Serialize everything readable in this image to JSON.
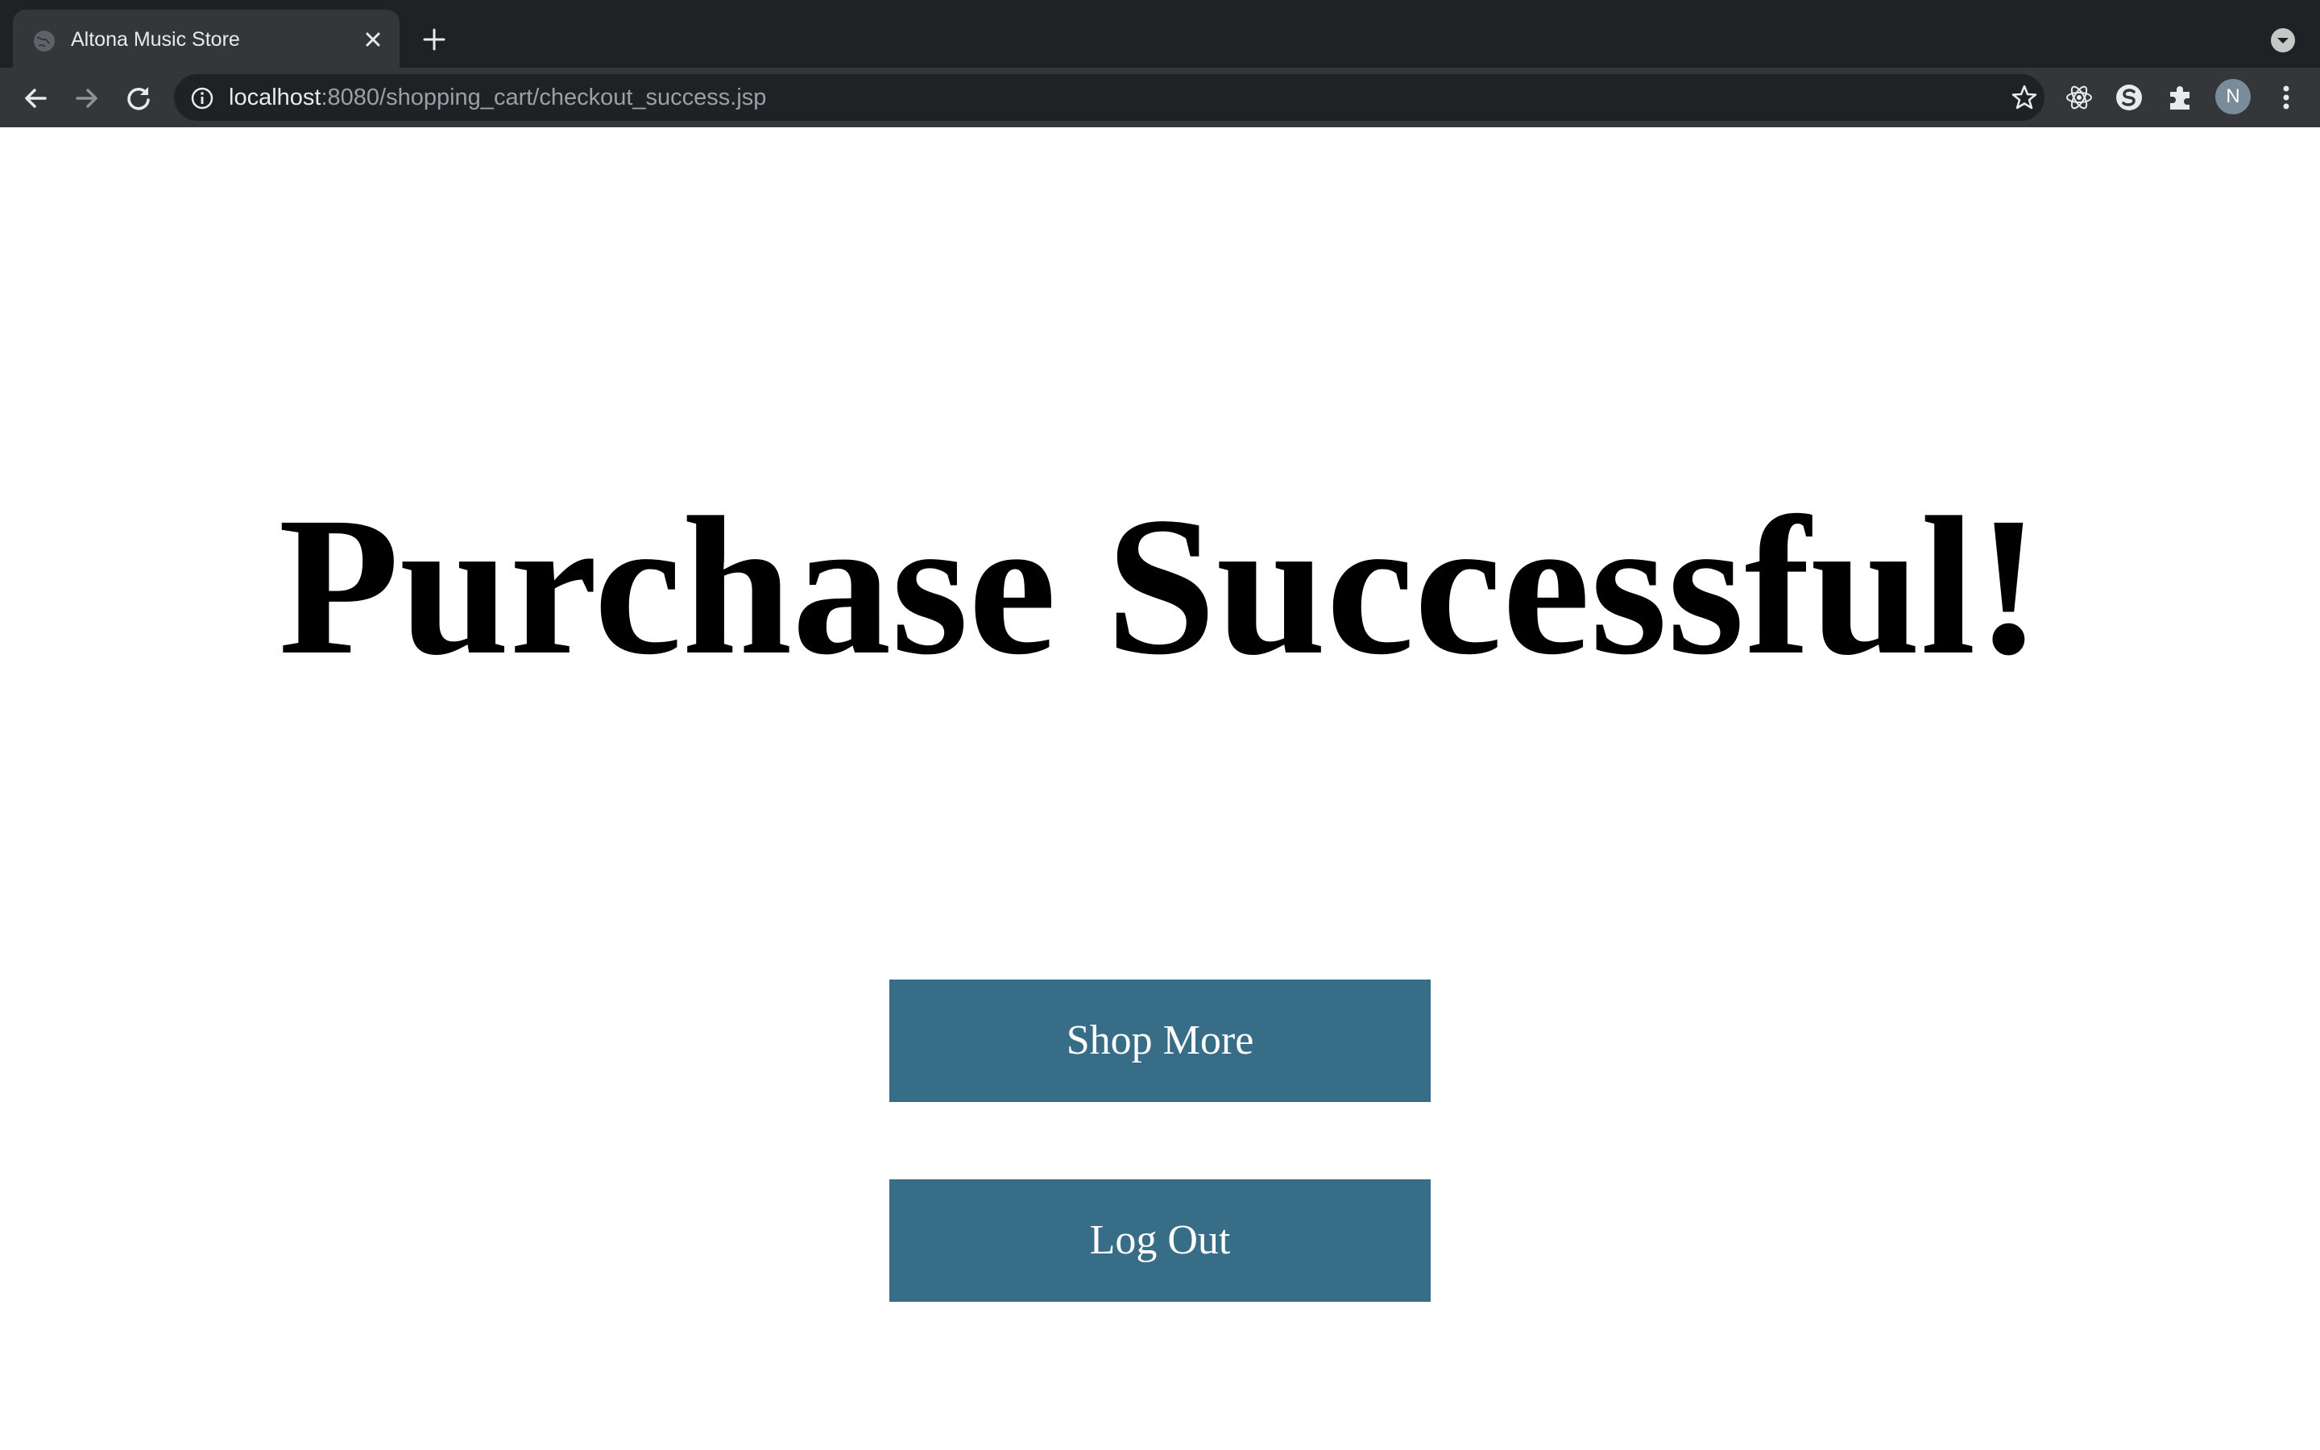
{
  "browser": {
    "tab": {
      "title": "Altona Music Store"
    },
    "address_bar": {
      "host": "localhost",
      "path": ":8080/shopping_cart/checkout_success.jsp"
    },
    "profile_initial": "N"
  },
  "page": {
    "heading": "Purchase Successful!",
    "buttons": {
      "shop_more": "Shop More",
      "log_out": "Log Out"
    }
  },
  "colors": {
    "button_background": "#376d87",
    "button_text": "#ffffff",
    "heading_text": "#000000",
    "tabbar_background": "#202124",
    "toolbar_background": "#35363a"
  },
  "icons": [
    "globe-icon",
    "close-icon",
    "plus-icon",
    "chevron-down-icon",
    "back-arrow-icon",
    "forward-arrow-icon",
    "reload-icon",
    "info-icon",
    "star-icon",
    "react-devtools-icon",
    "extension-s-icon",
    "puzzle-icon",
    "kebab-menu-icon"
  ]
}
